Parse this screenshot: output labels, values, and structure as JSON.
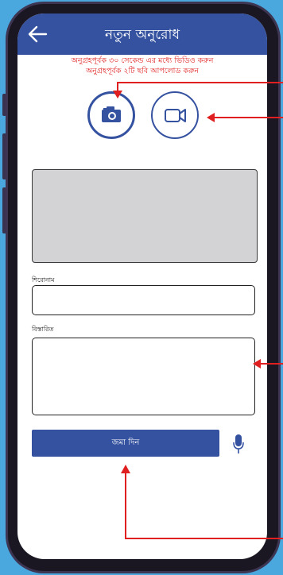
{
  "app_bar": {
    "title": "নতুন অনুরোধ",
    "back_icon": "back-arrow-icon"
  },
  "instructions": {
    "line1": "অনুগ্রহপূর্বক ৩০ সেকেন্ড এর মধ্যে ভিডিও করুন",
    "line2": "অনুগ্রহপূর্বক ২টি ছবি আপলোড করুন"
  },
  "media_buttons": {
    "camera_icon": "camera-icon",
    "video_icon": "video-camera-icon"
  },
  "form": {
    "title_label": "শিরোনাম",
    "title_value": "",
    "details_label": "বিস্তারিত",
    "details_value": "",
    "submit_label": "জমা দিন",
    "mic_icon": "microphone-icon"
  },
  "colors": {
    "background": "#4aa8de",
    "app_bar": "#3552a0",
    "instruction_text": "#e02020",
    "annotation_arrow": "#e02020"
  }
}
